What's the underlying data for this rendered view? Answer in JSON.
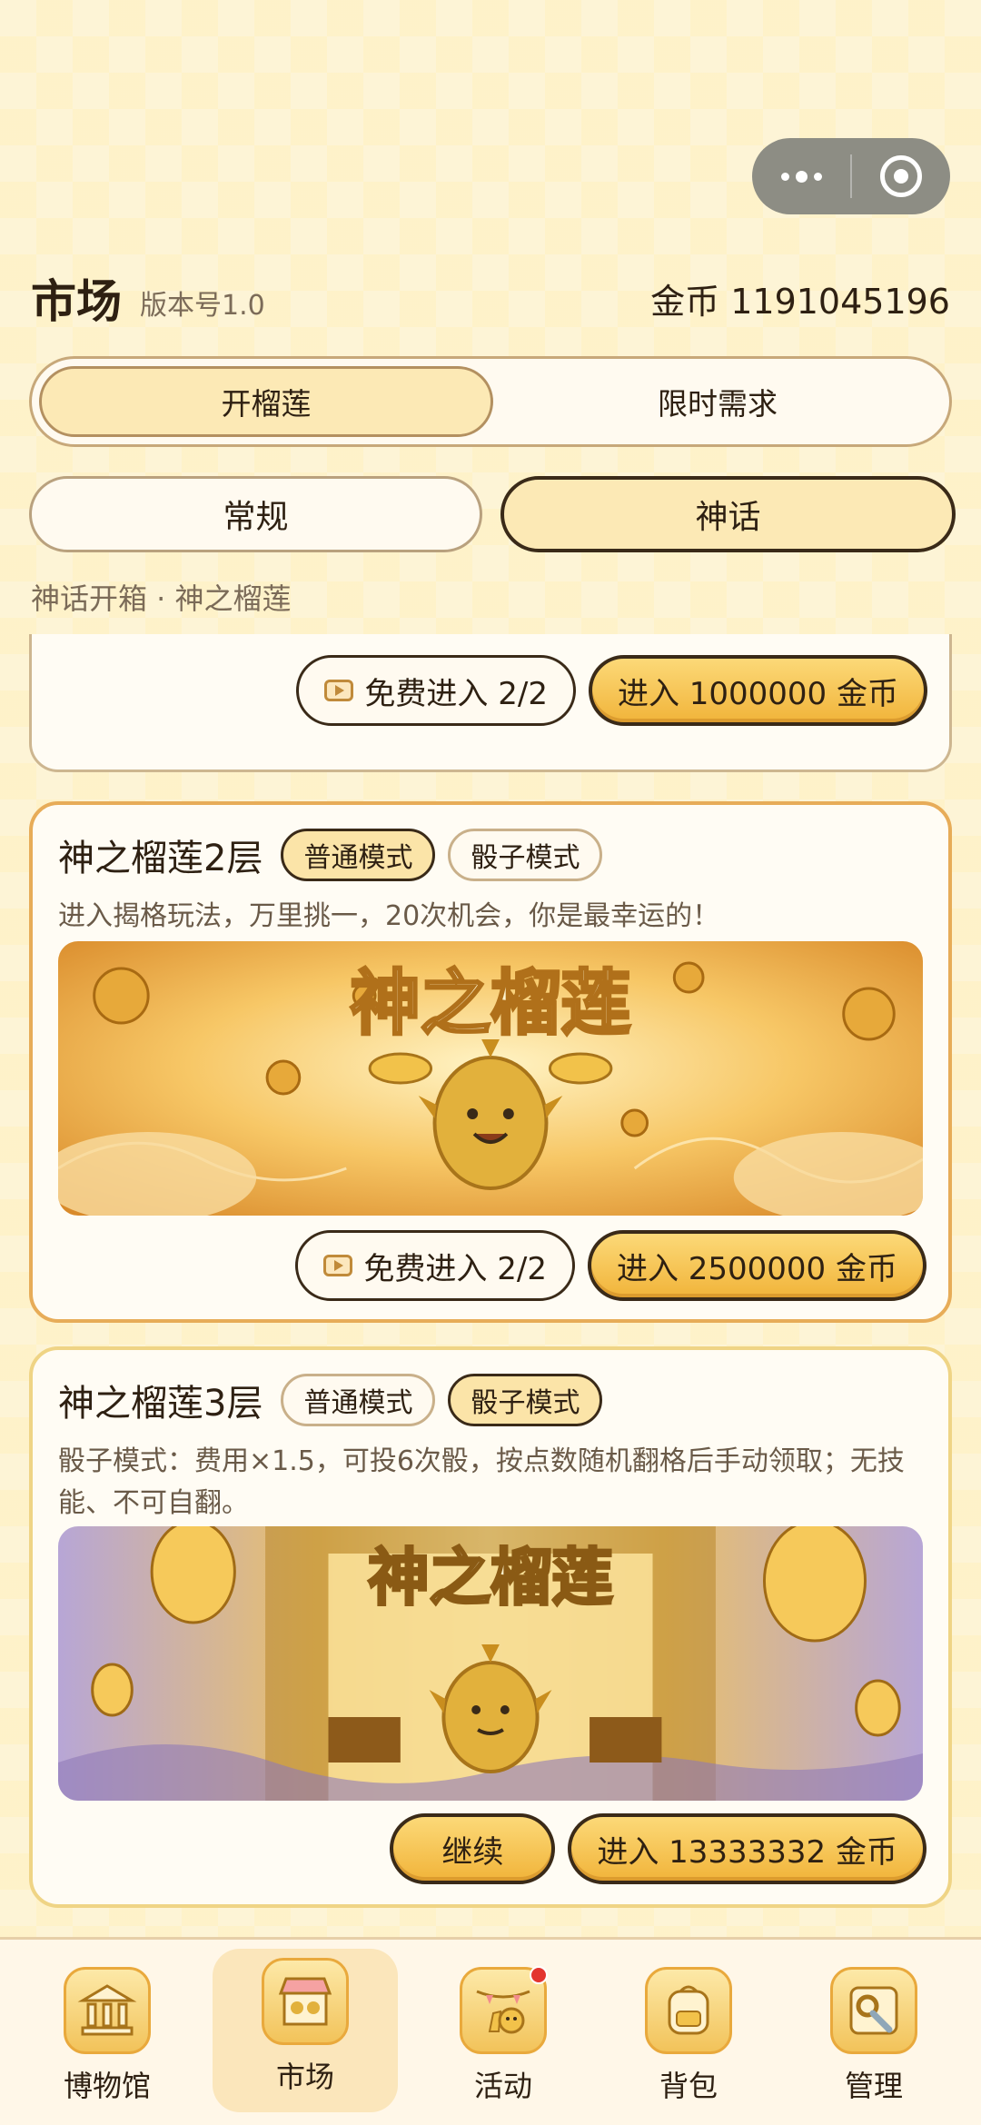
{
  "header": {
    "title": "市场",
    "version": "版本号1.0",
    "coins": "金币 1191045196"
  },
  "main_tabs": [
    {
      "label": "开榴莲",
      "active": true
    },
    {
      "label": "限时需求",
      "active": false
    }
  ],
  "sub_tabs": [
    {
      "label": "常规",
      "active": false
    },
    {
      "label": "神话",
      "active": true
    }
  ],
  "breadcrumb": "神话开箱 · 神之榴莲",
  "cards": [
    {
      "free_label": "免费进入 2/2",
      "enter_label": "进入 1000000 金币"
    },
    {
      "name": "神之榴莲2层",
      "modes": [
        {
          "label": "普通模式",
          "selected": true
        },
        {
          "label": "骰子模式",
          "selected": false
        }
      ],
      "desc": "进入揭格玩法，万里挑一，20次机会，你是最幸运的！",
      "banner_title": "神之榴莲",
      "free_label": "免费进入 2/2",
      "enter_label": "进入 2500000 金币"
    },
    {
      "name": "神之榴莲3层",
      "modes": [
        {
          "label": "普通模式",
          "selected": false
        },
        {
          "label": "骰子模式",
          "selected": true
        }
      ],
      "desc": "骰子模式：费用×1.5，可投6次骰，按点数随机翻格后手动领取；无技能、不可自翻。",
      "banner_title": "神之榴莲",
      "continue_label": "继续",
      "enter_label": "进入 13333332 金币"
    }
  ],
  "bottom_nav": [
    {
      "label": "博物馆",
      "icon": "museum-icon",
      "active": false
    },
    {
      "label": "市场",
      "icon": "market-stall-icon",
      "active": true
    },
    {
      "label": "活动",
      "icon": "event-icon",
      "active": false,
      "badge": true
    },
    {
      "label": "背包",
      "icon": "backpack-icon",
      "active": false
    },
    {
      "label": "管理",
      "icon": "settings-icon",
      "active": false
    }
  ],
  "colors": {
    "accent_gold": "#f1b43a",
    "card_border_2": "#e7ac58",
    "card_border_3": "#efd485",
    "badge_red": "#e3342f"
  }
}
